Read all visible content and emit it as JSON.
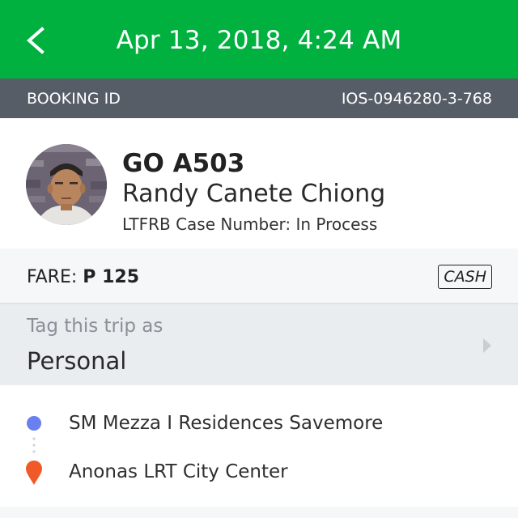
{
  "header": {
    "title": "Apr 13, 2018, 4:24 AM",
    "back_icon": "chevron-left-icon",
    "background_color": "#00b140"
  },
  "booking": {
    "label": "BOOKING ID",
    "value": "IOS-0946280-3-768"
  },
  "driver": {
    "plate": "GO A503",
    "name": "Randy Canete Chiong",
    "case_number": "LTFRB Case Number: In Process"
  },
  "fare": {
    "label": "FARE:",
    "amount": "P 125",
    "payment_badge": "CASH"
  },
  "tag": {
    "label": "Tag this trip as",
    "value": "Personal",
    "chevron_icon": "chevron-right-icon"
  },
  "route": {
    "pickup": "SM Mezza I Residences Savemore",
    "dropoff": "Anonas LRT City Center",
    "pickup_color": "#6a7ff0",
    "dropoff_color": "#f05a28"
  }
}
